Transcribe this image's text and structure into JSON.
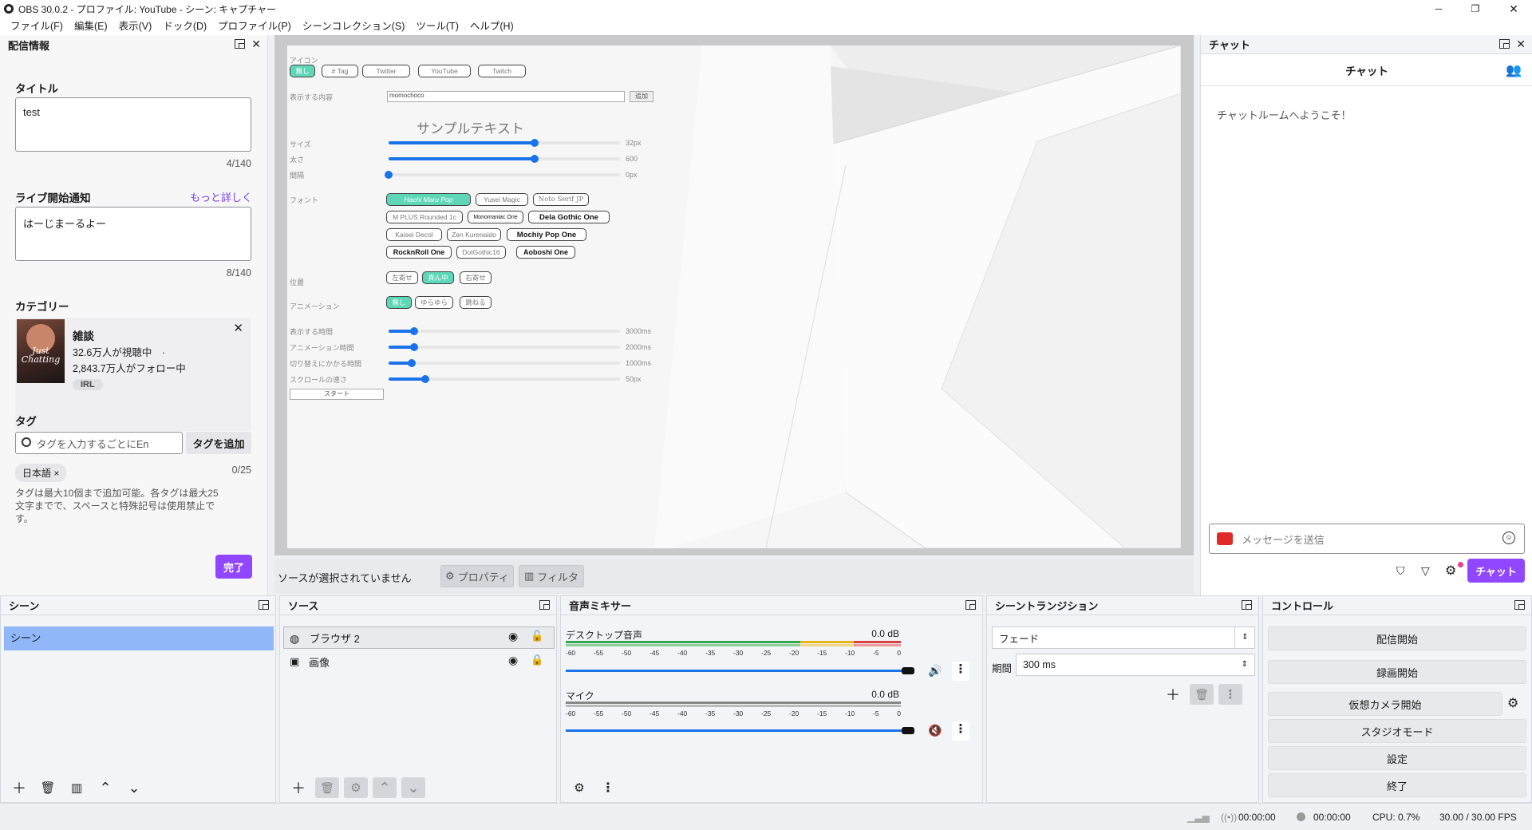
{
  "window": {
    "title": "OBS 30.0.2 - プロファイル: YouTube - シーン: キャプチャー"
  },
  "menu": [
    "ファイル(F)",
    "編集(E)",
    "表示(V)",
    "ドック(D)",
    "プロファイル(P)",
    "シーンコレクション(S)",
    "ツール(T)",
    "ヘルプ(H)"
  ],
  "stream_info": {
    "header": "配信情報",
    "title_label": "タイトル",
    "title_value": "test",
    "title_count": "4/140",
    "notice_label": "ライブ開始通知",
    "notice_link": "もっと詳しく",
    "notice_value": "はーじまーるよー",
    "notice_count": "8/140",
    "category_label": "カテゴリー",
    "category": {
      "name": "雑談",
      "viewers": "32.6万人が視聴中　·",
      "followers": "2,843.7万人がフォロー中",
      "tag": "IRL",
      "thumb_text": "Just Chatting"
    },
    "tag_label": "タグ",
    "tag_placeholder": "タグを入力するごとにEn",
    "tag_add": "タグを追加",
    "tag_count": "0/25",
    "tag_chip": "日本語 ×",
    "tag_help": "タグは最大10個まで追加可能。各タグは最大25文字までで、スペースと特殊記号は使用禁止です。",
    "done": "完了"
  },
  "overlay": {
    "icon_label": "アイコン",
    "icon_chips": [
      "無し",
      "# Tag",
      "Twitter",
      "YouTube",
      "Twitch"
    ],
    "content_label": "表示する内容",
    "content_value": "momochoco",
    "content_btn": "追加",
    "sample": "サンプルテキスト",
    "size_label": "サイズ",
    "size_value": "32px",
    "size_level": 0.63,
    "weight_label": "太さ",
    "weight_value": "600",
    "weight_level": 0.63,
    "spacing_label": "間隔",
    "spacing_value": "0px",
    "spacing_level": 0.0,
    "font_label": "フォント",
    "fonts_row1": [
      "Hachi Maru Pop",
      "Yusei Magic",
      "Noto Serif JP"
    ],
    "fonts_row2": [
      "M PLUS Rounded 1c",
      "Monomaniac One",
      "Dela Gothic One"
    ],
    "fonts_row3": [
      "Kaisei Decol",
      "Zen Kurenaido",
      "Mochiy Pop One"
    ],
    "fonts_row4": [
      "RocknRoll One",
      "DotGothic16",
      "Aoboshi One"
    ],
    "pos_label": "位置",
    "pos_chips": [
      "左寄せ",
      "真ん中",
      "右寄せ"
    ],
    "anim_label": "アニメーション",
    "anim_chips": [
      "無し",
      "ゆらゆら",
      "跳ねる"
    ],
    "time_rows": [
      {
        "label": "表示する時間",
        "value": "3000ms",
        "level": 0.11
      },
      {
        "label": "アニメーション時間",
        "value": "2000ms",
        "level": 0.11
      },
      {
        "label": "切り替えにかかる時間",
        "value": "1000ms",
        "level": 0.1
      },
      {
        "label": "スクロールの速さ",
        "value": "50px",
        "level": 0.16
      }
    ],
    "start": "スタート"
  },
  "source_bar": {
    "no_source": "ソースが選択されていません",
    "properties": "プロパティ",
    "filters": "フィルタ"
  },
  "chat": {
    "header": "チャット",
    "title": "チャット",
    "welcome": "チャットルームへようこそ！",
    "placeholder": "メッセージを送信",
    "send": "チャット"
  },
  "scenes": {
    "header": "シーン",
    "items": [
      "シーン"
    ]
  },
  "sources": {
    "header": "ソース",
    "items": [
      "ブラウザ 2",
      "画像"
    ]
  },
  "mixer": {
    "header": "音声ミキサー",
    "ticks": [
      "-60",
      "-55",
      "-50",
      "-45",
      "-40",
      "-35",
      "-30",
      "-25",
      "-20",
      "-15",
      "-10",
      "-5",
      "0"
    ],
    "channels": [
      {
        "name": "デスクトップ音声",
        "db": "0.0 dB",
        "volume": 0.98,
        "muted": false
      },
      {
        "name": "マイク",
        "db": "0.0 dB",
        "volume": 0.98,
        "muted": true
      }
    ]
  },
  "transitions": {
    "header": "シーントランジション",
    "selected": "フェード",
    "duration_label": "期間",
    "duration_value": "300 ms"
  },
  "controls": {
    "header": "コントロール",
    "buttons": [
      "配信開始",
      "録画開始",
      "仮想カメラ開始",
      "スタジオモード",
      "設定",
      "終了"
    ]
  },
  "status": {
    "stream_time": "00:00:00",
    "rec_time": "00:00:00",
    "cpu": "CPU: 0.7%",
    "fps": "30.00 / 30.00 FPS"
  },
  "colors": {
    "accent": "#9147ff",
    "mint": "#5ed6b8",
    "blue": "#1a73e8",
    "scene_sel": "#90b8f8"
  }
}
